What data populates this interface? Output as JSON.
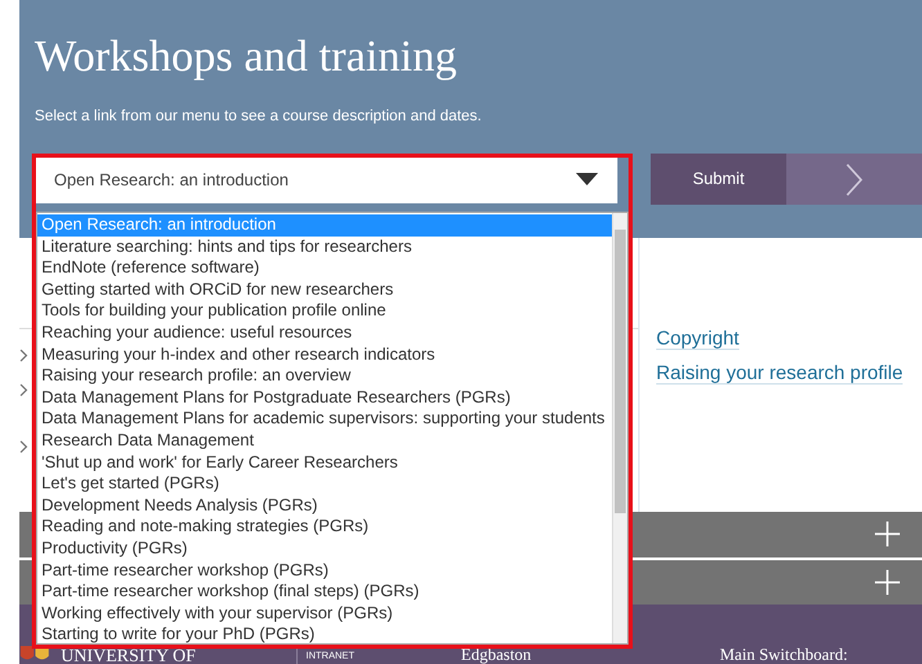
{
  "header": {
    "title": "Workshops and training",
    "subtitle": "Select a link from our menu to see a course description and dates."
  },
  "course_select": {
    "value": "Open Research: an introduction",
    "expanded": true,
    "options": [
      {
        "label": "Open Research: an introduction",
        "selected": true
      },
      {
        "label": "Literature searching: hints and tips for researchers",
        "selected": false
      },
      {
        "label": "EndNote (reference software)",
        "selected": false
      },
      {
        "label": "Getting started with ORCiD for new researchers",
        "selected": false
      },
      {
        "label": "Tools for building your publication profile online",
        "selected": false
      },
      {
        "label": "Reaching your audience: useful resources",
        "selected": false
      },
      {
        "label": "Measuring your h-index and other research indicators",
        "selected": false
      },
      {
        "label": "Raising your research profile: an overview",
        "selected": false
      },
      {
        "label": "Data Management Plans for Postgraduate Researchers (PGRs)",
        "selected": false
      },
      {
        "label": "Data Management Plans for academic supervisors: supporting your students",
        "selected": false
      },
      {
        "label": "Research Data Management",
        "selected": false
      },
      {
        "label": "'Shut up and work' for Early Career Researchers",
        "selected": false
      },
      {
        "label": "Let's get started (PGRs)",
        "selected": false
      },
      {
        "label": "Development Needs Analysis (PGRs)",
        "selected": false
      },
      {
        "label": "Reading and note-making strategies (PGRs)",
        "selected": false
      },
      {
        "label": "Productivity (PGRs)",
        "selected": false
      },
      {
        "label": "Part-time researcher workshop (PGRs)",
        "selected": false
      },
      {
        "label": "Part-time researcher workshop (final steps) (PGRs)",
        "selected": false
      },
      {
        "label": "Working effectively with your supervisor (PGRs)",
        "selected": false
      },
      {
        "label": "Starting to write for your PhD (PGRs)",
        "selected": false
      }
    ]
  },
  "submit_button": "Submit",
  "related_links": [
    "Copyright",
    "Raising your research profile"
  ],
  "accordion": [
    {
      "expanded": false
    },
    {
      "expanded": false
    }
  ],
  "footer": {
    "university": "UNIVERSITY OF",
    "intranet": "INTRANET",
    "campus": "Edgbaston",
    "switchboard": "Main Switchboard:"
  }
}
